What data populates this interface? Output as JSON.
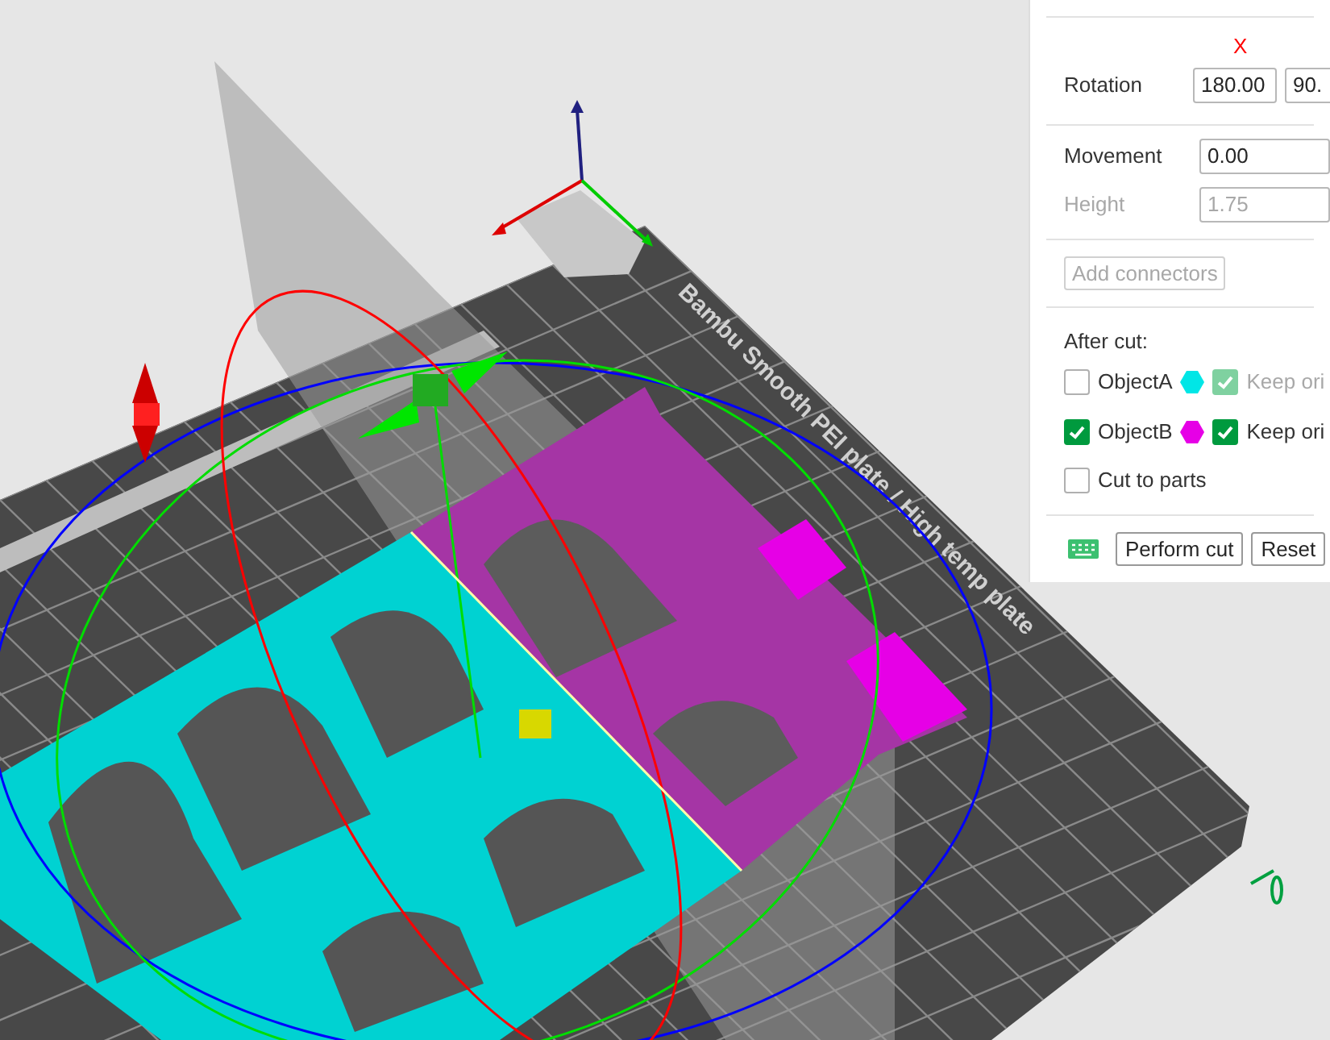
{
  "viewport": {
    "bed_label": "Bambu Smooth PEI plate / High temp plate"
  },
  "panel": {
    "axis_header": "X",
    "rotation": {
      "label": "Rotation",
      "values": [
        "180.00",
        "90."
      ]
    },
    "movement": {
      "label": "Movement",
      "value": "0.00"
    },
    "height": {
      "label": "Height",
      "value": "1.75",
      "disabled": true
    },
    "add_connectors": {
      "label": "Add connectors",
      "disabled": true
    },
    "after_cut_label": "After cut:",
    "objects": [
      {
        "label": "ObjectA",
        "checked": false,
        "color": "#00e6e6",
        "keep_label": "Keep ori",
        "keep_checked": true,
        "keep_disabled": true
      },
      {
        "label": "ObjectB",
        "checked": true,
        "color": "#e600e6",
        "keep_label": "Keep ori",
        "keep_checked": true,
        "keep_disabled": false
      }
    ],
    "cut_to_parts": {
      "label": "Cut to parts",
      "checked": false
    },
    "buttons": [
      "Perform cut",
      "Reset"
    ]
  }
}
